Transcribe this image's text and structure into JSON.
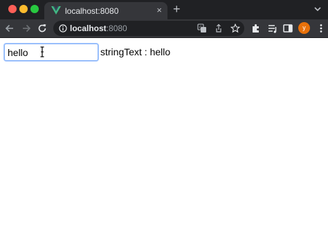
{
  "browser": {
    "tab": {
      "title": "localhost:8080",
      "favicon": "vue-logo-icon",
      "close_label": "×"
    },
    "new_tab_label": "+",
    "address_bar": {
      "host": "localhost",
      "port": ":8080"
    },
    "avatar_letter": "y",
    "colors": {
      "tab_strip": "#202124",
      "toolbar": "#35363a",
      "avatar": "#e8710a",
      "vue_green": "#41b883",
      "vue_dark": "#34495e"
    }
  },
  "page": {
    "input": {
      "value": "hello"
    },
    "output": {
      "label": "stringText : ",
      "value": "hello"
    }
  }
}
